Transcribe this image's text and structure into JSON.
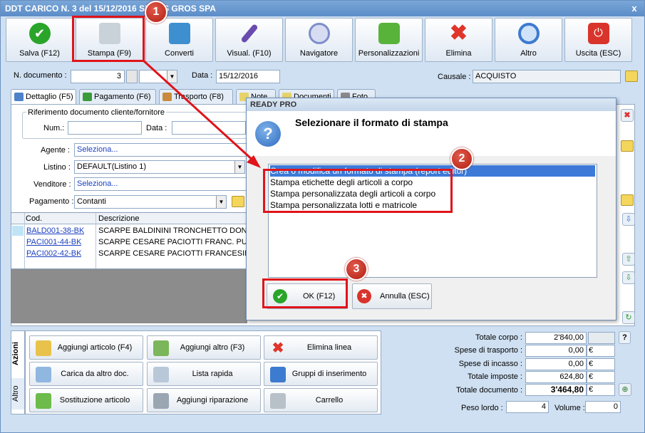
{
  "window": {
    "title": "DDT CARICO N. 3 del 15/12/2016 SHOES GROS SPA",
    "close": "x"
  },
  "toolbar": [
    {
      "label": "Salva (F12)",
      "icon": "checkmark-icon",
      "color": "#2aa52a"
    },
    {
      "label": "Stampa (F9)",
      "icon": "printer-icon",
      "color": "#9aa6b2"
    },
    {
      "label": "Converti",
      "icon": "convert-icon",
      "color": "#3d8fd0"
    },
    {
      "label": "Visual. (F10)",
      "icon": "magic-wand-icon",
      "color": "#6a4bb0"
    },
    {
      "label": "Navigatore",
      "icon": "compass-icon",
      "color": "#7d8fc9"
    },
    {
      "label": "Personalizzazioni",
      "icon": "puzzle-icon",
      "color": "#58b33a"
    },
    {
      "label": "Elimina",
      "icon": "red-x-icon",
      "color": "#e0352a"
    },
    {
      "label": "Altro",
      "icon": "magnifier-icon",
      "color": "#3d7bd0"
    },
    {
      "label": "Uscita (ESC)",
      "icon": "power-icon",
      "color": "#d9342b"
    }
  ],
  "header": {
    "doc_label": "N. documento :",
    "doc_number": "3",
    "date_label": "Data :",
    "date": "15/12/2016",
    "causale_label": "Causale :",
    "causale": "ACQUISTO"
  },
  "tabs": [
    "Dettaglio (F5)",
    "Pagamento (F6)",
    "Trasporto (F8)",
    "Note",
    "Documenti",
    "Foto"
  ],
  "riferimento": {
    "legend": "Riferimento documento cliente/fornitore",
    "num_label": "Num.:",
    "data_label": "Data :"
  },
  "form": {
    "agente_label": "Agente :",
    "agente": "Seleziona...",
    "listino_label": "Listino :",
    "listino": "DEFAULT(Listino 1)",
    "venditore_label": "Venditore :",
    "venditore": "Seleziona...",
    "pagamento_label": "Pagamento :",
    "pagamento": "Contanti"
  },
  "grid": {
    "headers": [
      "Cod.",
      "Descrizione"
    ],
    "rows": [
      {
        "cod": "BALD001-38-BK",
        "desc": "SCARPE BALDININI TRONCHETTO DONNA T"
      },
      {
        "cod": "PACI001-44-BK",
        "desc": "SCARPE CESARE PACIOTTI FRANC. PUNTA"
      },
      {
        "cod": "PACI002-42-BK",
        "desc": "SCARPE CESARE PACIOTTI FRANCESINA"
      }
    ]
  },
  "dialog": {
    "title": "READY PRO",
    "heading": "Selezionare il formato di stampa",
    "items": [
      "Crea o modifica un formato di stampa (report editor)",
      "Stampa etichette degli articoli a corpo",
      "Stampa personalizzata degli articoli a corpo",
      "Stampa personalizzata lotti e matricole"
    ],
    "ok_label": "OK (F12)",
    "cancel_label": "Annulla (ESC)"
  },
  "badges": [
    "1",
    "2",
    "3"
  ],
  "side_tabs": [
    "Azioni",
    "Altro"
  ],
  "actions": [
    "Aggiungi articolo (F4)",
    "Aggiungi altro (F3)",
    "Elimina linea",
    "Carica da altro doc.",
    "Lista rapida",
    "Gruppi di inserimento",
    "Sostituzione articolo",
    "Aggiungi riparazione",
    "Carrello"
  ],
  "totals": [
    {
      "label": "Totale corpo :",
      "value": "2'840,00",
      "unit": ""
    },
    {
      "label": "Spese di trasporto :",
      "value": "0,00",
      "unit": "€"
    },
    {
      "label": "Spese di incasso :",
      "value": "0,00",
      "unit": "€"
    },
    {
      "label": "Totale imposte :",
      "value": "624,80",
      "unit": "€"
    },
    {
      "label": "Totale documento :",
      "value": "3'464,80",
      "unit": "€"
    }
  ],
  "help": "?",
  "peso": {
    "label": "Peso lordo :",
    "value": "4",
    "volume_label": "Volume :",
    "volume": "0"
  },
  "colors": {
    "accent_red": "#e0141a",
    "selection": "#3d7ad8"
  }
}
